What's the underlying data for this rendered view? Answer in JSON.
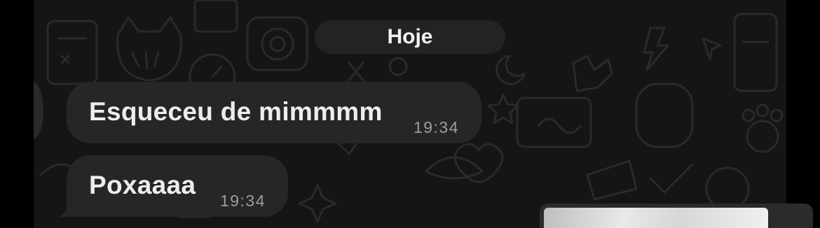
{
  "date_chip": {
    "label": "Hoje"
  },
  "messages": [
    {
      "text": "Esqueceu de mimmmm",
      "time": "19:34"
    },
    {
      "text": "Poxaaaa",
      "time": "19:34"
    }
  ],
  "colors": {
    "chat_background": "#151515",
    "bubble_background": "#262626",
    "text": "#ededed",
    "timestamp": "#9d9d9d"
  }
}
